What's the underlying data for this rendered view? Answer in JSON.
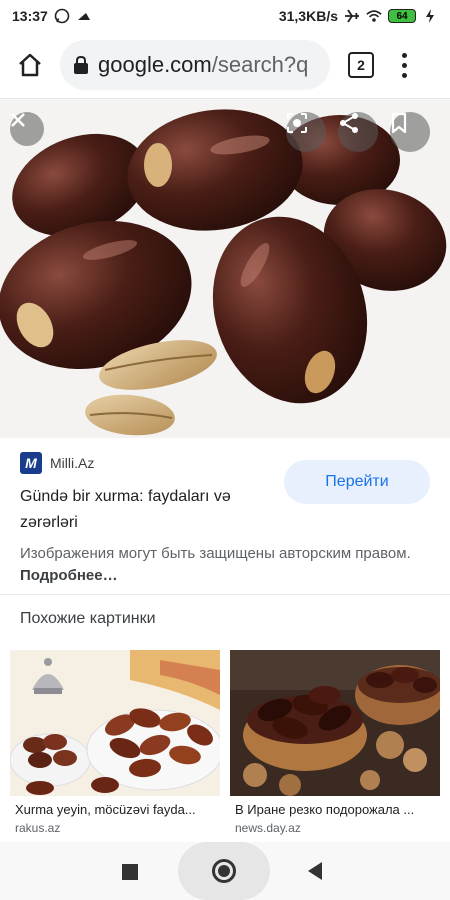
{
  "status_bar": {
    "time": "13:37",
    "network_speed": "31,3KB/s",
    "battery": "64",
    "icons": [
      "whatsapp-icon",
      "app-icon",
      "airplane-icon",
      "wifi-icon",
      "battery-icon",
      "charging-icon"
    ]
  },
  "toolbar": {
    "url_domain": "google.com",
    "url_path": "/search?q",
    "tab_count": "2"
  },
  "hero": {
    "image_description": "dates-photo",
    "overlay_buttons": [
      "close-icon",
      "lens-icon",
      "share-icon",
      "bookmark-icon"
    ]
  },
  "result": {
    "source_favicon": "M",
    "source_name": "Milli.Az",
    "title": "Gündə bir xurma: faydaları və zərərləri",
    "visit_label": "Перейти",
    "copyright_text": "Изображения могут быть защищены авторским правом.",
    "copyright_link": "Подробнее…"
  },
  "similar": {
    "heading": "Похожие картинки",
    "items": [
      {
        "caption": "Xurma yeyin, möcüzəvi fayda...",
        "domain": "rakus.az"
      },
      {
        "caption": "В Иране резко подорожала ...",
        "domain": "news.day.az"
      }
    ]
  },
  "colors": {
    "accent": "#1a73e8",
    "visit_bg": "#e8f0fe",
    "omnibox_bg": "#f1f3f4",
    "favicon_bg": "#1a3c8c",
    "date_brown": "#4a1e16"
  }
}
